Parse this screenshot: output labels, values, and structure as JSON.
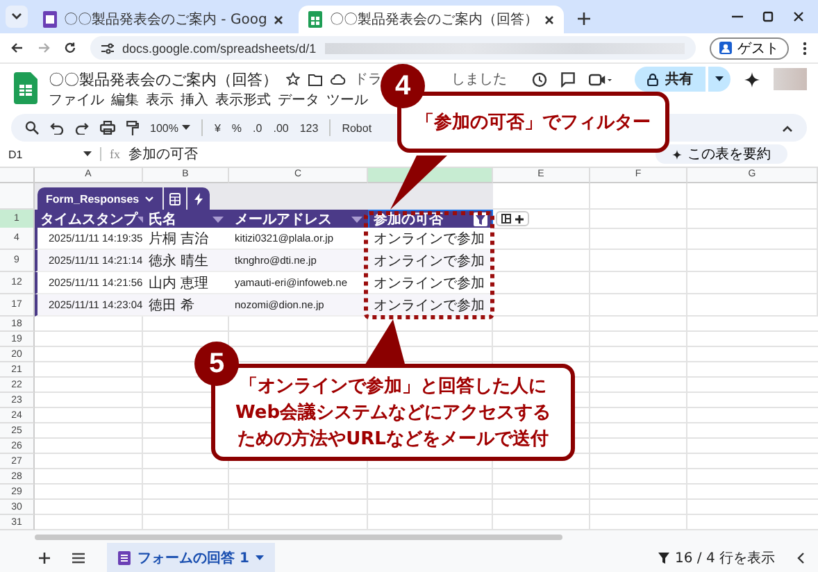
{
  "browser": {
    "tabs": [
      {
        "title": "〇〇製品発表会のご案内 - Goog",
        "selected": false,
        "kind": "forms"
      },
      {
        "title": "〇〇製品発表会のご案内（回答）",
        "selected": true,
        "kind": "sheets"
      }
    ],
    "url": "docs.google.com/spreadsheets/d/1",
    "profile": "ゲスト"
  },
  "sheet": {
    "title": "〇〇製品発表会のご案内（回答）",
    "status_start": "ドラ",
    "status_end": "しました",
    "share": "共有",
    "menu": [
      "ファイル",
      "編集",
      "表示",
      "挿入",
      "表示形式",
      "データ",
      "ツール"
    ]
  },
  "toolbar": {
    "zoom": "100%",
    "format_items": [
      "¥",
      "%",
      ".0",
      ".00",
      "123"
    ],
    "font": "Robot",
    "summarize": "この表を要約"
  },
  "formula_bar": {
    "cell": "D1",
    "fx_label": "fx",
    "content": "参加の可否"
  },
  "columns": [
    {
      "letter": "A",
      "selected": false
    },
    {
      "letter": "B",
      "selected": false
    },
    {
      "letter": "C",
      "selected": false
    },
    {
      "selected": true
    },
    {
      "letter": "E",
      "selected": false
    },
    {
      "letter": "F",
      "selected": false
    },
    {
      "letter": "G",
      "selected": false
    }
  ],
  "table": {
    "name": "Form_Responses",
    "header_row": "1",
    "headers": [
      "タイムスタンプ",
      "氏名",
      "メールアドレス",
      "参加の可否"
    ],
    "rows": [
      {
        "number": "4",
        "cells": [
          "2025/11/11 14:19:35",
          "片桐 吉治",
          "kitizi0321@plala.or.jp",
          "オンラインで参加"
        ]
      },
      {
        "number": "9",
        "cells": [
          "2025/11/11 14:21:14",
          "徳永 晴生",
          "tknghro@dti.ne.jp",
          "オンラインで参加"
        ]
      },
      {
        "number": "12",
        "cells": [
          "2025/11/11 14:21:56",
          "山内 恵理",
          "yamauti-eri@infoweb.ne",
          "オンラインで参加"
        ]
      },
      {
        "number": "17",
        "cells": [
          "2025/11/11 14:23:04",
          "徳田 希",
          "nozomi@dion.ne.jp",
          "オンラインで参加"
        ]
      }
    ]
  },
  "empty_rows": [
    "18",
    "19",
    "20",
    "21",
    "22",
    "23",
    "24",
    "25",
    "26",
    "27",
    "28",
    "29",
    "30",
    "31"
  ],
  "sheet_tabs": [
    {
      "label": "フォームの回答 1",
      "selected": true
    }
  ],
  "row_status": "16 / 4 行を表示",
  "callouts": [
    {
      "number": "4",
      "lines": [
        "「参加の可否」でフィルター"
      ]
    },
    {
      "number": "5",
      "lines": [
        "「オンラインで参加」と回答した人に",
        "Web会議システムなどにアクセスする",
        "ための方法やURLなどをメールで送付"
      ]
    }
  ]
}
